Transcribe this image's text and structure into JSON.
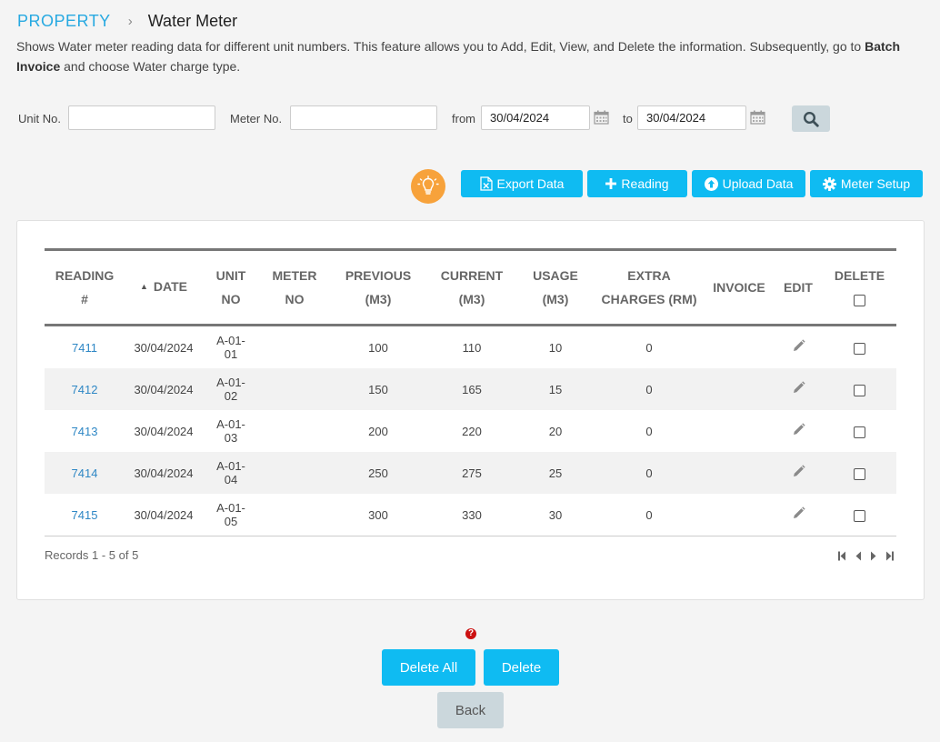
{
  "breadcrumb": {
    "root": "PROPERTY",
    "separator": "›",
    "page": "Water Meter"
  },
  "description": {
    "part1": "Shows Water meter reading data for different unit numbers. This feature allows you to Add, Edit, View, and Delete the information. Subsequently, go to ",
    "bold": "Batch Invoice",
    "part2": " and choose Water charge type."
  },
  "filters": {
    "unit_label": "Unit No.",
    "unit_value": "",
    "meter_label": "Meter No.",
    "meter_value": "",
    "from_label": "from",
    "from_value": "30/04/2024",
    "to_label": "to",
    "to_value": "30/04/2024"
  },
  "toolbar": {
    "export_label": "Export Data",
    "reading_label": "Reading",
    "upload_label": "Upload Data",
    "meter_setup_label": "Meter Setup"
  },
  "table": {
    "headers": {
      "reading_l1": "READING",
      "reading_l2": "#",
      "date": "DATE",
      "unit_l1": "UNIT",
      "unit_l2": "NO",
      "meter_l1": "METER",
      "meter_l2": "NO",
      "previous_l1": "PREVIOUS",
      "previous_l2": "(M3)",
      "current_l1": "CURRENT",
      "current_l2": "(M3)",
      "usage_l1": "USAGE",
      "usage_l2": "(M3)",
      "extra_l1": "EXTRA",
      "extra_l2": "CHARGES (RM)",
      "invoice": "INVOICE",
      "edit": "EDIT",
      "delete": "DELETE"
    },
    "rows": [
      {
        "reading": "7411",
        "date": "30/04/2024",
        "unit_l1": "A-01-",
        "unit_l2": "01",
        "meter": "",
        "previous": "100",
        "current": "110",
        "usage": "10",
        "extra": "0",
        "invoice": ""
      },
      {
        "reading": "7412",
        "date": "30/04/2024",
        "unit_l1": "A-01-",
        "unit_l2": "02",
        "meter": "",
        "previous": "150",
        "current": "165",
        "usage": "15",
        "extra": "0",
        "invoice": ""
      },
      {
        "reading": "7413",
        "date": "30/04/2024",
        "unit_l1": "A-01-",
        "unit_l2": "03",
        "meter": "",
        "previous": "200",
        "current": "220",
        "usage": "20",
        "extra": "0",
        "invoice": ""
      },
      {
        "reading": "7414",
        "date": "30/04/2024",
        "unit_l1": "A-01-",
        "unit_l2": "04",
        "meter": "",
        "previous": "250",
        "current": "275",
        "usage": "25",
        "extra": "0",
        "invoice": ""
      },
      {
        "reading": "7415",
        "date": "30/04/2024",
        "unit_l1": "A-01-",
        "unit_l2": "05",
        "meter": "",
        "previous": "300",
        "current": "330",
        "usage": "30",
        "extra": "0",
        "invoice": ""
      }
    ],
    "records_text": "Records 1 - 5 of 5"
  },
  "footer": {
    "help_glyph": "?",
    "delete_all_label": "Delete All",
    "delete_label": "Delete",
    "back_label": "Back"
  },
  "colors": {
    "accent": "#0fbbf2",
    "link": "#2e87c5",
    "breadcrumb": "#27a9e1",
    "hint": "#f7a23b",
    "secondary_button": "#cbd7dc"
  }
}
